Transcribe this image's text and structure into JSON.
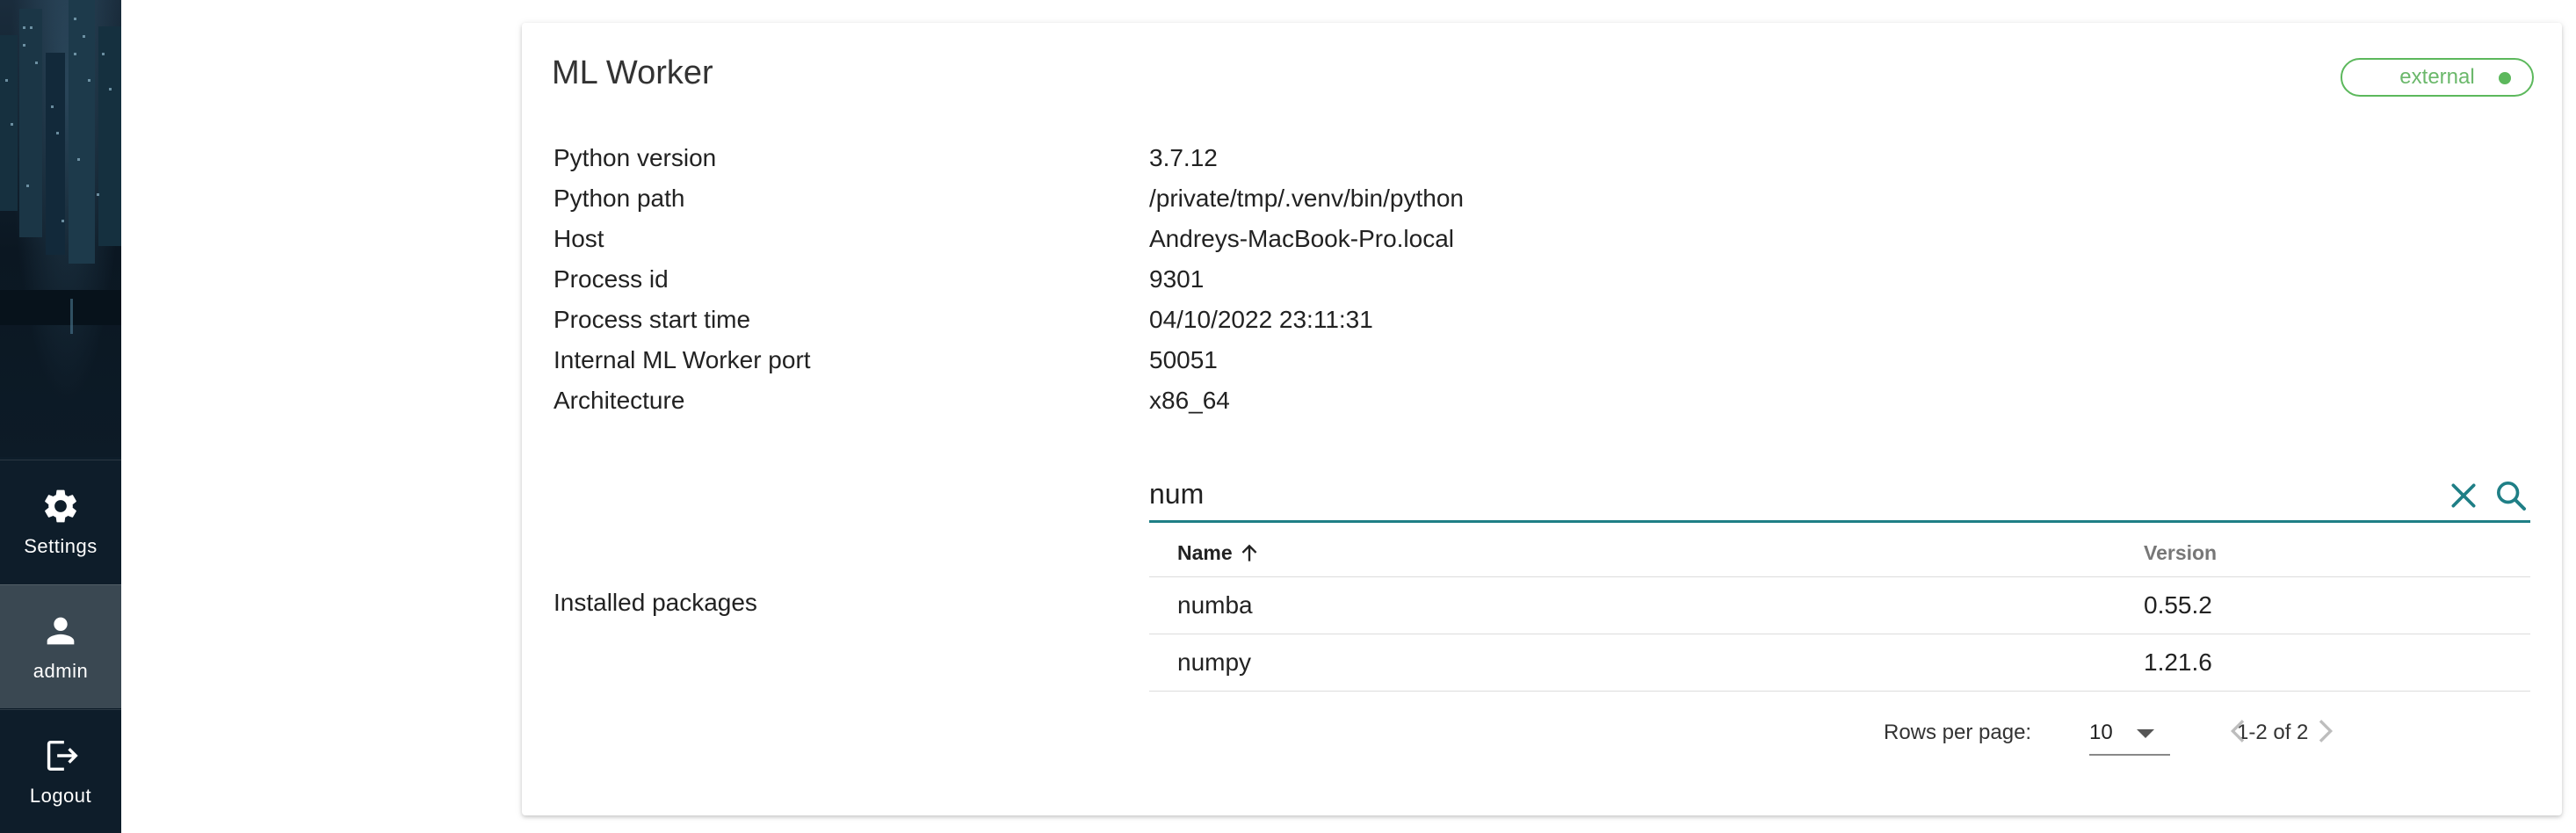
{
  "sidebar": {
    "items": [
      {
        "label": "Settings",
        "icon": "gear-icon"
      },
      {
        "label": "admin",
        "icon": "person-icon"
      },
      {
        "label": "Logout",
        "icon": "logout-icon"
      }
    ]
  },
  "card": {
    "title": "ML Worker",
    "badge": "external",
    "info": [
      {
        "label": "Python version",
        "value": "3.7.12"
      },
      {
        "label": "Python path",
        "value": "/private/tmp/.venv/bin/python"
      },
      {
        "label": "Host",
        "value": "Andreys-MacBook-Pro.local"
      },
      {
        "label": "Process id",
        "value": "9301"
      },
      {
        "label": "Process start time",
        "value": "04/10/2022 23:11:31"
      },
      {
        "label": "Internal ML Worker port",
        "value": "50051"
      },
      {
        "label": "Architecture",
        "value": "x86_64"
      }
    ],
    "packages_label": "Installed packages"
  },
  "search": {
    "value": "num"
  },
  "table": {
    "headers": {
      "name": "Name",
      "version": "Version"
    },
    "rows": [
      {
        "name": "numba",
        "version": "0.55.2"
      },
      {
        "name": "numpy",
        "version": "1.21.6"
      }
    ]
  },
  "pagination": {
    "rows_per_page_label": "Rows per page:",
    "rows_per_page": "10",
    "range": "1-2 of 2"
  },
  "colors": {
    "accent": "#1f7f86",
    "status_green": "#5cb85c",
    "sidebar_bg": "#0e1d2a",
    "sidebar_active": "#3a4852"
  }
}
